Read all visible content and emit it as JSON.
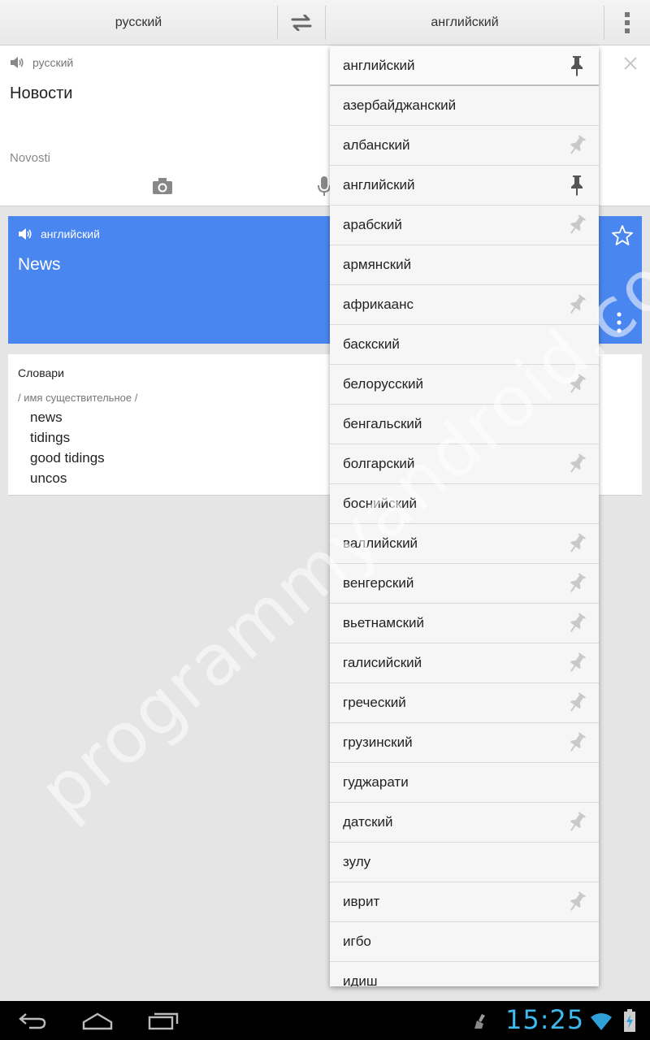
{
  "topbar": {
    "source_language": "русский",
    "target_language": "английский",
    "swap_icon": "swap-arrows-icon",
    "menu_icon": "overflow-menu-icon"
  },
  "input_card": {
    "language": "русский",
    "text": "Новости",
    "transliteration": "Novosti"
  },
  "result_card": {
    "language": "английский",
    "text": "News"
  },
  "dictionary": {
    "title": "Словари",
    "part_of_speech": "/ имя существительное /",
    "words": [
      "news",
      "tidings",
      "good tidings",
      "uncos"
    ]
  },
  "dropdown": {
    "selected": "английский",
    "items": [
      {
        "label": "азербайджанский",
        "pin": "none"
      },
      {
        "label": "албанский",
        "pin": "light"
      },
      {
        "label": "английский",
        "pin": "dark"
      },
      {
        "label": "арабский",
        "pin": "light"
      },
      {
        "label": "армянский",
        "pin": "none"
      },
      {
        "label": "африкаанс",
        "pin": "light"
      },
      {
        "label": "баскский",
        "pin": "none"
      },
      {
        "label": "белорусский",
        "pin": "light"
      },
      {
        "label": "бенгальский",
        "pin": "none"
      },
      {
        "label": "болгарский",
        "pin": "light"
      },
      {
        "label": "боснийский",
        "pin": "none"
      },
      {
        "label": "валлийский",
        "pin": "light"
      },
      {
        "label": "венгерский",
        "pin": "light"
      },
      {
        "label": "вьетнамский",
        "pin": "light"
      },
      {
        "label": "галисийский",
        "pin": "light"
      },
      {
        "label": "греческий",
        "pin": "light"
      },
      {
        "label": "грузинский",
        "pin": "light"
      },
      {
        "label": "гуджарати",
        "pin": "none"
      },
      {
        "label": "датский",
        "pin": "light"
      },
      {
        "label": "зулу",
        "pin": "none"
      },
      {
        "label": "иврит",
        "pin": "light"
      },
      {
        "label": "игбо",
        "pin": "none"
      },
      {
        "label": "идиш",
        "pin": "none"
      }
    ]
  },
  "watermark": "programmyandroid.com",
  "status_bar": {
    "time": "15:25"
  },
  "colors": {
    "accent": "#4a86f0",
    "clock": "#3fb8ee"
  }
}
